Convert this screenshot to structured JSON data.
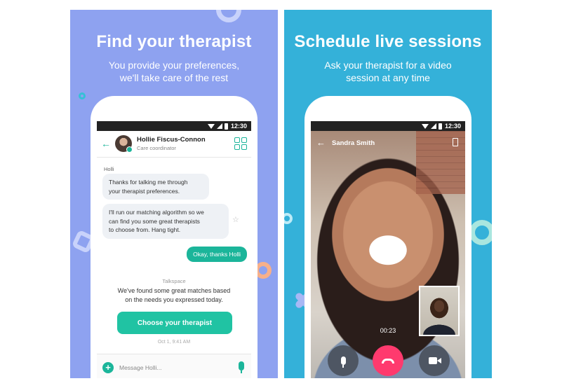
{
  "colors": {
    "left_panel_bg": "#8ea2f0",
    "right_panel_bg": "#34b1d9",
    "accent_green": "#1bb59a",
    "end_call_pink": "#ff3a6e"
  },
  "left": {
    "headline": "Find your therapist",
    "subline": "You provide your preferences,\nwe'll take care of the rest",
    "status_time": "12:30",
    "chat": {
      "contact_name": "Hollie Fiscus-Connon",
      "contact_role": "Care coordinator",
      "sender_label": "Holli",
      "message_1": "Thanks for talking me through\nyour therapist preferences.",
      "message_2": "I'll run our matching algorithm so we\ncan find you some great therapists\nto choose from. Hang tight.",
      "reply": "Okay, thanks Holli",
      "system_label": "Talkspace",
      "system_text": "We've found some great matches based\non the needs you expressed today.",
      "cta_label": "Choose your therapist",
      "timestamp": "Oct 1, 9:41 AM",
      "composer_placeholder": "Message Holli..."
    }
  },
  "right": {
    "headline": "Schedule live sessions",
    "subline": "Ask your therapist for a video\nsession at any time",
    "status_time": "12:30",
    "call": {
      "caller_name": "Sandra Smith",
      "timer": "00:23"
    }
  }
}
